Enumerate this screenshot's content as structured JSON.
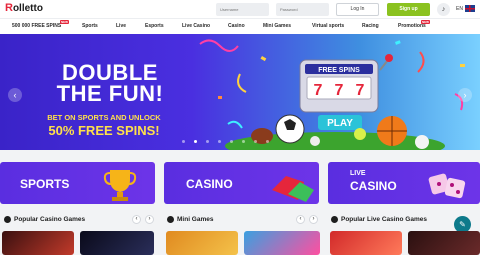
{
  "header": {
    "logo_text": "olletto",
    "logo_initial": "R",
    "username_placeholder": "Username",
    "password_placeholder": "Password",
    "login_label": "Log In",
    "signup_label": "Sign up",
    "lang": "EN"
  },
  "nav": {
    "items": [
      {
        "label": "500 000 FREE SPINS",
        "new": true
      },
      {
        "label": "Sports"
      },
      {
        "label": "Live"
      },
      {
        "label": "Esports"
      },
      {
        "label": "Live Casino"
      },
      {
        "label": "Casino"
      },
      {
        "label": "Mini Games"
      },
      {
        "label": "Virtual sports"
      },
      {
        "label": "Racing"
      },
      {
        "label": "Promotions",
        "new": true
      }
    ],
    "new_badge": "NEW"
  },
  "hero": {
    "title": "DOUBLE THE FUN!",
    "line1": "BET ON SPORTS AND UNLOCK",
    "line2": "50% FREE SPINS!",
    "slot_label": "FREE SPINS",
    "slot_reels": [
      "7",
      "7",
      "7"
    ],
    "play_label": "PLAY",
    "slide_count": 8,
    "active_slide": 1
  },
  "categories": [
    {
      "label": "SPORTS"
    },
    {
      "label": "CASINO"
    },
    {
      "label_top": "LIVE",
      "label": "CASINO"
    }
  ],
  "sections": [
    {
      "title": "Popular Casino Games"
    },
    {
      "title": "Mini Games"
    },
    {
      "title": "Popular Live Casino Games"
    }
  ],
  "colors": {
    "brand_red": "#e5263b",
    "signup_green": "#8bc21f",
    "hero_purple": "#3a23c8",
    "category_purple": "#5a2ee0"
  }
}
